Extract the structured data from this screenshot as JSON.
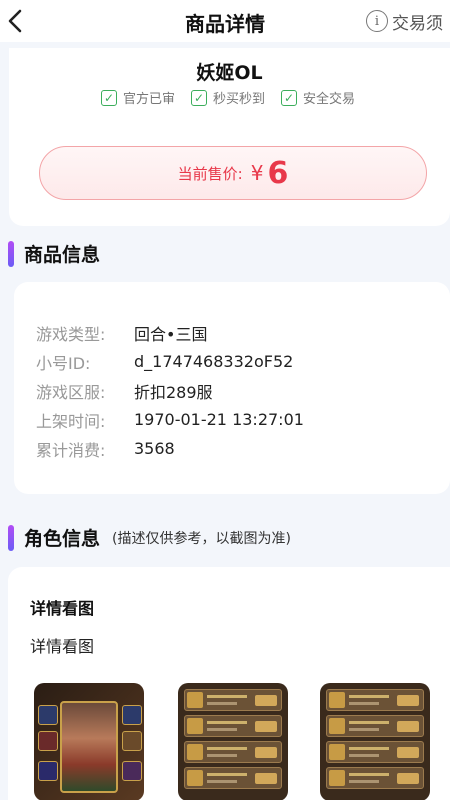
{
  "header": {
    "back_icon": "chevron-left-icon",
    "title": "商品详情",
    "notice_icon": "info-icon",
    "notice_label": "交易须"
  },
  "product": {
    "game_name": "妖姬OL",
    "tags": [
      "官方已审",
      "秒买秒到",
      "安全交易"
    ],
    "price_label": "当前售价:",
    "price_currency": "¥",
    "price_value": "6"
  },
  "product_info": {
    "section_title": "商品信息",
    "rows": [
      {
        "label": "游戏类型:",
        "value": "回合•三国"
      },
      {
        "label": "小号ID:",
        "value": "d_1747468332oF52"
      },
      {
        "label": "游戏区服:",
        "value": "折扣289服"
      },
      {
        "label": "上架时间:",
        "value": "1970-01-21 13:27:01"
      },
      {
        "label": "累计消费:",
        "value": "3568"
      }
    ]
  },
  "role_info": {
    "section_title": "角色信息",
    "section_note": "(描述仅供参考，以截图为准)",
    "detail_title": "详情看图",
    "detail_desc": "详情看图"
  },
  "colors": {
    "price_red": "#e8384a",
    "check_green": "#3cae5c",
    "section_bar_top": "#b24cf5",
    "section_bar_bottom": "#6a5cf5"
  }
}
